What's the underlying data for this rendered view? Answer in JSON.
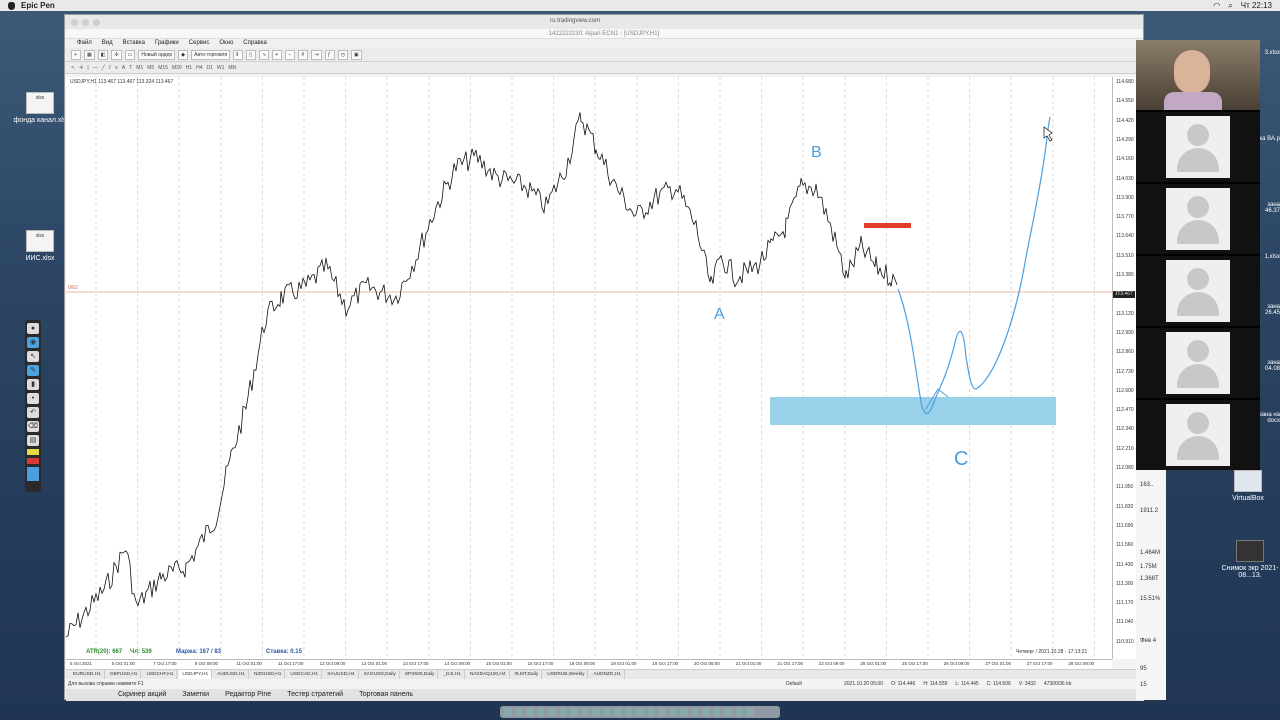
{
  "menubar": {
    "app_name": "Epic Pen",
    "clock": "Чт 22:13"
  },
  "desktop_icons": [
    {
      "label": "фонда канал.xls"
    },
    {
      "label": "ИИС.xlsx"
    },
    {
      "label": "VirtualBox"
    },
    {
      "label": "Снимок экр 2021-08...13."
    }
  ],
  "browser": {
    "url": "ru.tradingview.com",
    "window_title": "1422222230: Alpari-ECN1 - [USDJPY,H1]",
    "menu": [
      "Файл",
      "Вид",
      "Вставка",
      "Графики",
      "Сервис",
      "Окно",
      "Справка"
    ],
    "toolbar": {
      "new_order": "Новый ордер",
      "auto_trading": "Авто-торговля"
    },
    "timeframes": [
      "M1",
      "M5",
      "M15",
      "M30",
      "H1",
      "H4",
      "D1",
      "W1",
      "MN"
    ]
  },
  "chart": {
    "symbol_info": "USDJPY,H1 113.467 113.467 113.324 113.467",
    "stats": {
      "atr": "ATR(20): 667",
      "ch_label": "Чл: 539",
      "margin": "Маржа: 167 / 83",
      "stake": "Ставка: 0.15"
    },
    "timestamp": "Четверг / 2021.10.28 - 17:13:21",
    "annotations": {
      "a": "A",
      "b": "B",
      "c": "C"
    },
    "y_ticks": [
      "114.680",
      "114.550",
      "114.420",
      "114.290",
      "114.160",
      "114.030",
      "113.900",
      "113.770",
      "113.640",
      "113.510",
      "113.380",
      "113.250",
      "113.120",
      "112.990",
      "112.860",
      "112.730",
      "112.600",
      "112.470",
      "112.340",
      "112.210",
      "112.080",
      "111.950",
      "111.820",
      "111.690",
      "111.560",
      "111.430",
      "111.300",
      "111.170",
      "111.040",
      "110.910"
    ],
    "current_price": "113.467",
    "x_ticks": [
      "5 Oct 2021",
      "6 Oct 01:00",
      "7 Oct 17:00",
      "8 Oct 09:00",
      "11 Oct 01:00",
      "11 Oct 17:00",
      "12 Oct 09:00",
      "13 Oct 01:00",
      "13 Oct 17:00",
      "14 Oct 09:00",
      "15 Oct 01:00",
      "15 Oct 17:00",
      "18 Oct 09:00",
      "19 Oct 01:00",
      "19 Oct 17:00",
      "20 Oct 09:00",
      "21 Oct 01:00",
      "21 Oct 17:00",
      "22 Oct 09:00",
      "25 Oct 01:00",
      "25 Oct 17:00",
      "26 Oct 09:00",
      "27 Oct 01:00",
      "27 Oct 17:00",
      "28 Oct 09:00"
    ],
    "hline_label": "0/62"
  },
  "symbol_tabs": [
    "EURUSD,H1",
    "GBPUSD,H1",
    "USDCHF,H1",
    "USDJPY,H1",
    "AUDUSD,H1",
    "NZDUSD,H1",
    "USDCAD,H1",
    "XAUUSD,H4",
    "XAGUSD,Daily",
    "SPX500,Daily",
    "_DJI,H1",
    "NASDAQ100,H4",
    "#LMT,Daily",
    "USDRUB,Weekly",
    "AUDNZD,H1"
  ],
  "active_tab": "USDJPY,H1",
  "statusbar": {
    "help": "Для вызова справки нажмите F1",
    "profile": "Default",
    "datetime": "2021.10.20 05:00",
    "open": "O: 114.446",
    "high": "H: 114.559",
    "low": "L: 114.445",
    "close": "C: 114.506",
    "volume": "V: 3432",
    "traffic": "47300/36 kb"
  },
  "bottom_panel": [
    "Скринер акций",
    "Заметки",
    "Редактор Pine",
    "Тестер стратегий",
    "Торговая панель"
  ],
  "side_panel": {
    "v1": "163..",
    "v2": "1911.2",
    "v3": "1.464M",
    "v4": "1.75M",
    "v5": "1.368T",
    "v6": "15.51%",
    "v7": "Фев 4",
    "v8": "95",
    "v9": "15"
  },
  "right_labels": [
    "3.xlsx",
    "ка ВА.p",
    "зана",
    "46.37",
    "1.xlsx",
    "зана",
    "26.45",
    "зана",
    "04.08",
    "зана на",
    "docx"
  ],
  "colors": {
    "drawing_blue": "#4a9ee0",
    "zone_fill": "#8ecbe8",
    "resistance_red": "#e23b2b"
  }
}
